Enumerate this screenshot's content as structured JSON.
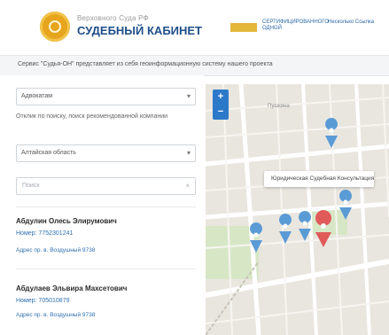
{
  "header": {
    "logo_small": "Верховного Суда РФ",
    "logo_title": "СУДЕБНЫЙ КАБИНЕТ",
    "partner1_text": "СЕРТИФИЦИРОВАННОГО ОДНОЙ",
    "partner2_text": "Несколько Ссылка"
  },
  "notice": {
    "text": "Сервис \"Судья-ОН\" представляет из себя геоинформационную систему нашего проекта"
  },
  "filters": {
    "region_select": "Адвокатам",
    "hint": "Отклик по поиску, поиск рекомендованной компании",
    "area_select": "Алтайская область",
    "search_placeholder": "Поиск",
    "search_clear": "×",
    "chevron": "▾"
  },
  "results": [
    {
      "name": "Абдулин Олесь Элирумович",
      "phone": "Номер: 7752301241",
      "addr": "Адрес пр. в. Воздушный 9738"
    },
    {
      "name": "Абдулаев Эльвира Махсетович",
      "phone": "Номер: 705010879",
      "addr": "Адрес пр. в. Воздушный 9738"
    }
  ],
  "map": {
    "zoom_in": "+",
    "zoom_out": "−",
    "tooltip": "Юридическая Судебная Консультация",
    "street_label": "Пушкина",
    "marker_color": "#5b9bd5",
    "active_marker_color": "#e05a5a"
  }
}
